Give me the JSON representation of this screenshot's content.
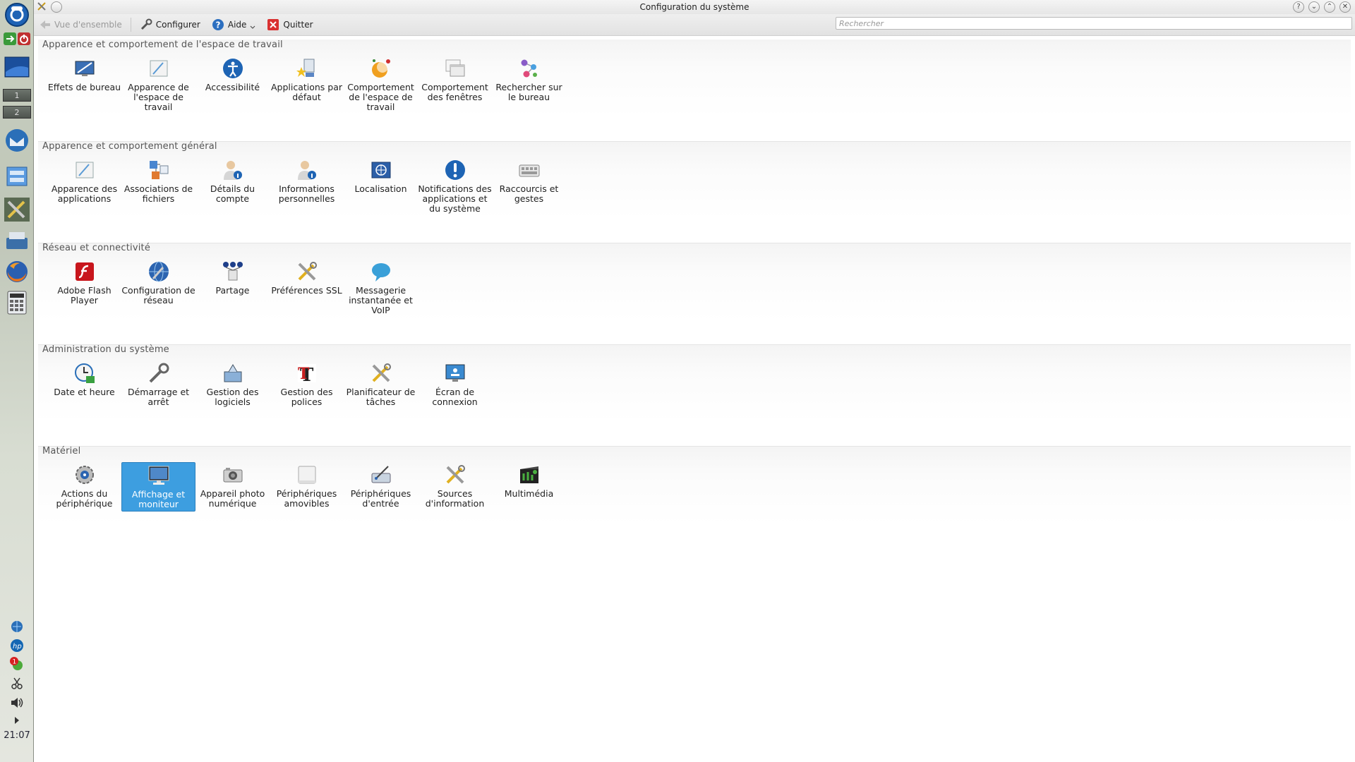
{
  "window": {
    "title": "Configuration du système"
  },
  "toolbar": {
    "overview_label": "Vue d'ensemble",
    "configure_label": "Configurer",
    "help_label": "Aide",
    "quit_label": "Quitter"
  },
  "search": {
    "placeholder": "Rechercher"
  },
  "panel": {
    "desktop_1": "1",
    "desktop_2": "2",
    "clock": "21:07",
    "notification_count": "1"
  },
  "colors": {
    "selection": "#3d9ee0",
    "accent_blue": "#1f6fc2"
  },
  "categories": [
    {
      "title": "Apparence et comportement de l'espace de travail",
      "items": [
        {
          "label": "Effets de bureau",
          "icon": "desktop-effects-icon"
        },
        {
          "label": "Apparence de l'espace de travail",
          "icon": "workspace-appearance-icon"
        },
        {
          "label": "Accessibilité",
          "icon": "accessibility-icon"
        },
        {
          "label": "Applications par défaut",
          "icon": "default-applications-icon"
        },
        {
          "label": "Comportement de l'espace de travail",
          "icon": "workspace-behavior-icon"
        },
        {
          "label": "Comportement des fenêtres",
          "icon": "window-behavior-icon"
        },
        {
          "label": "Rechercher sur le bureau",
          "icon": "desktop-search-icon"
        }
      ]
    },
    {
      "title": "Apparence et comportement général",
      "items": [
        {
          "label": "Apparence des applications",
          "icon": "application-appearance-icon"
        },
        {
          "label": "Associations de fichiers",
          "icon": "file-associations-icon"
        },
        {
          "label": "Détails du compte",
          "icon": "account-details-icon"
        },
        {
          "label": "Informations personnelles",
          "icon": "personal-info-icon"
        },
        {
          "label": "Localisation",
          "icon": "locale-icon"
        },
        {
          "label": "Notifications des applications et du système",
          "icon": "notifications-icon"
        },
        {
          "label": "Raccourcis et gestes",
          "icon": "shortcuts-icon"
        }
      ]
    },
    {
      "title": "Réseau et connectivité",
      "items": [
        {
          "label": "Adobe Flash Player",
          "icon": "flash-player-icon"
        },
        {
          "label": "Configuration de réseau",
          "icon": "network-settings-icon"
        },
        {
          "label": "Partage",
          "icon": "sharing-icon"
        },
        {
          "label": "Préférences SSL",
          "icon": "ssl-preferences-icon"
        },
        {
          "label": "Messagerie instantanée et VoIP",
          "icon": "instant-messaging-icon"
        }
      ]
    },
    {
      "title": "Administration du système",
      "items": [
        {
          "label": "Date et heure",
          "icon": "date-time-icon"
        },
        {
          "label": "Démarrage et arrêt",
          "icon": "startup-shutdown-icon"
        },
        {
          "label": "Gestion des logiciels",
          "icon": "software-management-icon"
        },
        {
          "label": "Gestion des polices",
          "icon": "font-management-icon"
        },
        {
          "label": "Planificateur de tâches",
          "icon": "task-scheduler-icon"
        },
        {
          "label": "Écran de connexion",
          "icon": "login-screen-icon"
        }
      ]
    },
    {
      "title": "Matériel",
      "items": [
        {
          "label": "Actions du périphérique",
          "icon": "device-actions-icon"
        },
        {
          "label": "Affichage et moniteur",
          "icon": "display-monitor-icon",
          "selected": true
        },
        {
          "label": "Appareil photo numérique",
          "icon": "digital-camera-icon"
        },
        {
          "label": "Périphériques amovibles",
          "icon": "removable-devices-icon"
        },
        {
          "label": "Périphériques d'entrée",
          "icon": "input-devices-icon"
        },
        {
          "label": "Sources d'information",
          "icon": "information-sources-icon"
        },
        {
          "label": "Multimédia",
          "icon": "multimedia-icon"
        }
      ]
    }
  ]
}
